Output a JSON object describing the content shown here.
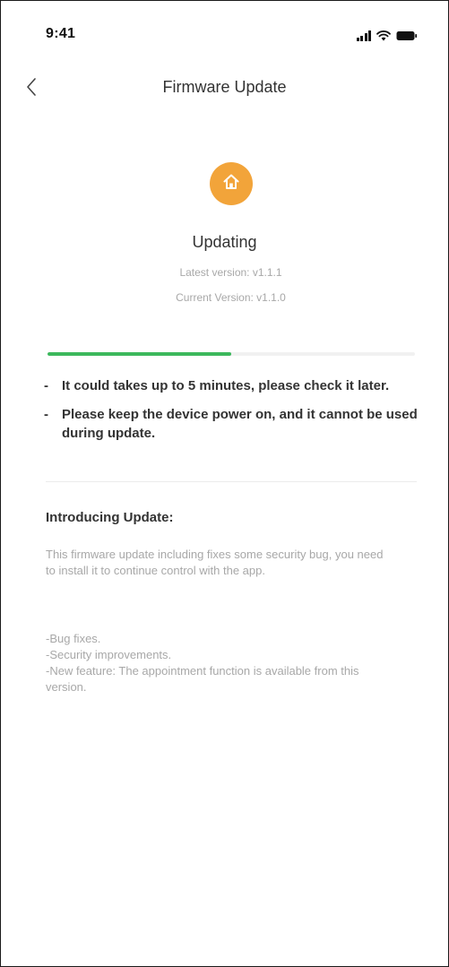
{
  "status_bar": {
    "time": "9:41",
    "icons": [
      "signal-icon",
      "wifi-icon",
      "battery-icon"
    ]
  },
  "nav": {
    "back_icon": "chevron-left-icon",
    "title": "Firmware Update"
  },
  "device": {
    "icon": "home-icon",
    "badge_color": "#f2a43a"
  },
  "update": {
    "status": "Updating",
    "latest_version": "Latest version: v1.1.1",
    "current_version": "Current Version: v1.1.0",
    "progress_fraction": 0.5,
    "progress_color": "#3cb85c"
  },
  "notes": [
    {
      "dash": "-",
      "text": "It could takes up to 5 minutes, please check it later."
    },
    {
      "dash": "-",
      "text": "Please keep the device power on, and it cannot be used during update."
    }
  ],
  "intro": {
    "heading": "Introducing Update:",
    "body": "This firmware update including fixes some security bug, you need to install it to continue control with the app.",
    "items": [
      "-Bug fixes.",
      "-Security improvements.",
      "-New feature: The appointment function is available from this version."
    ]
  }
}
